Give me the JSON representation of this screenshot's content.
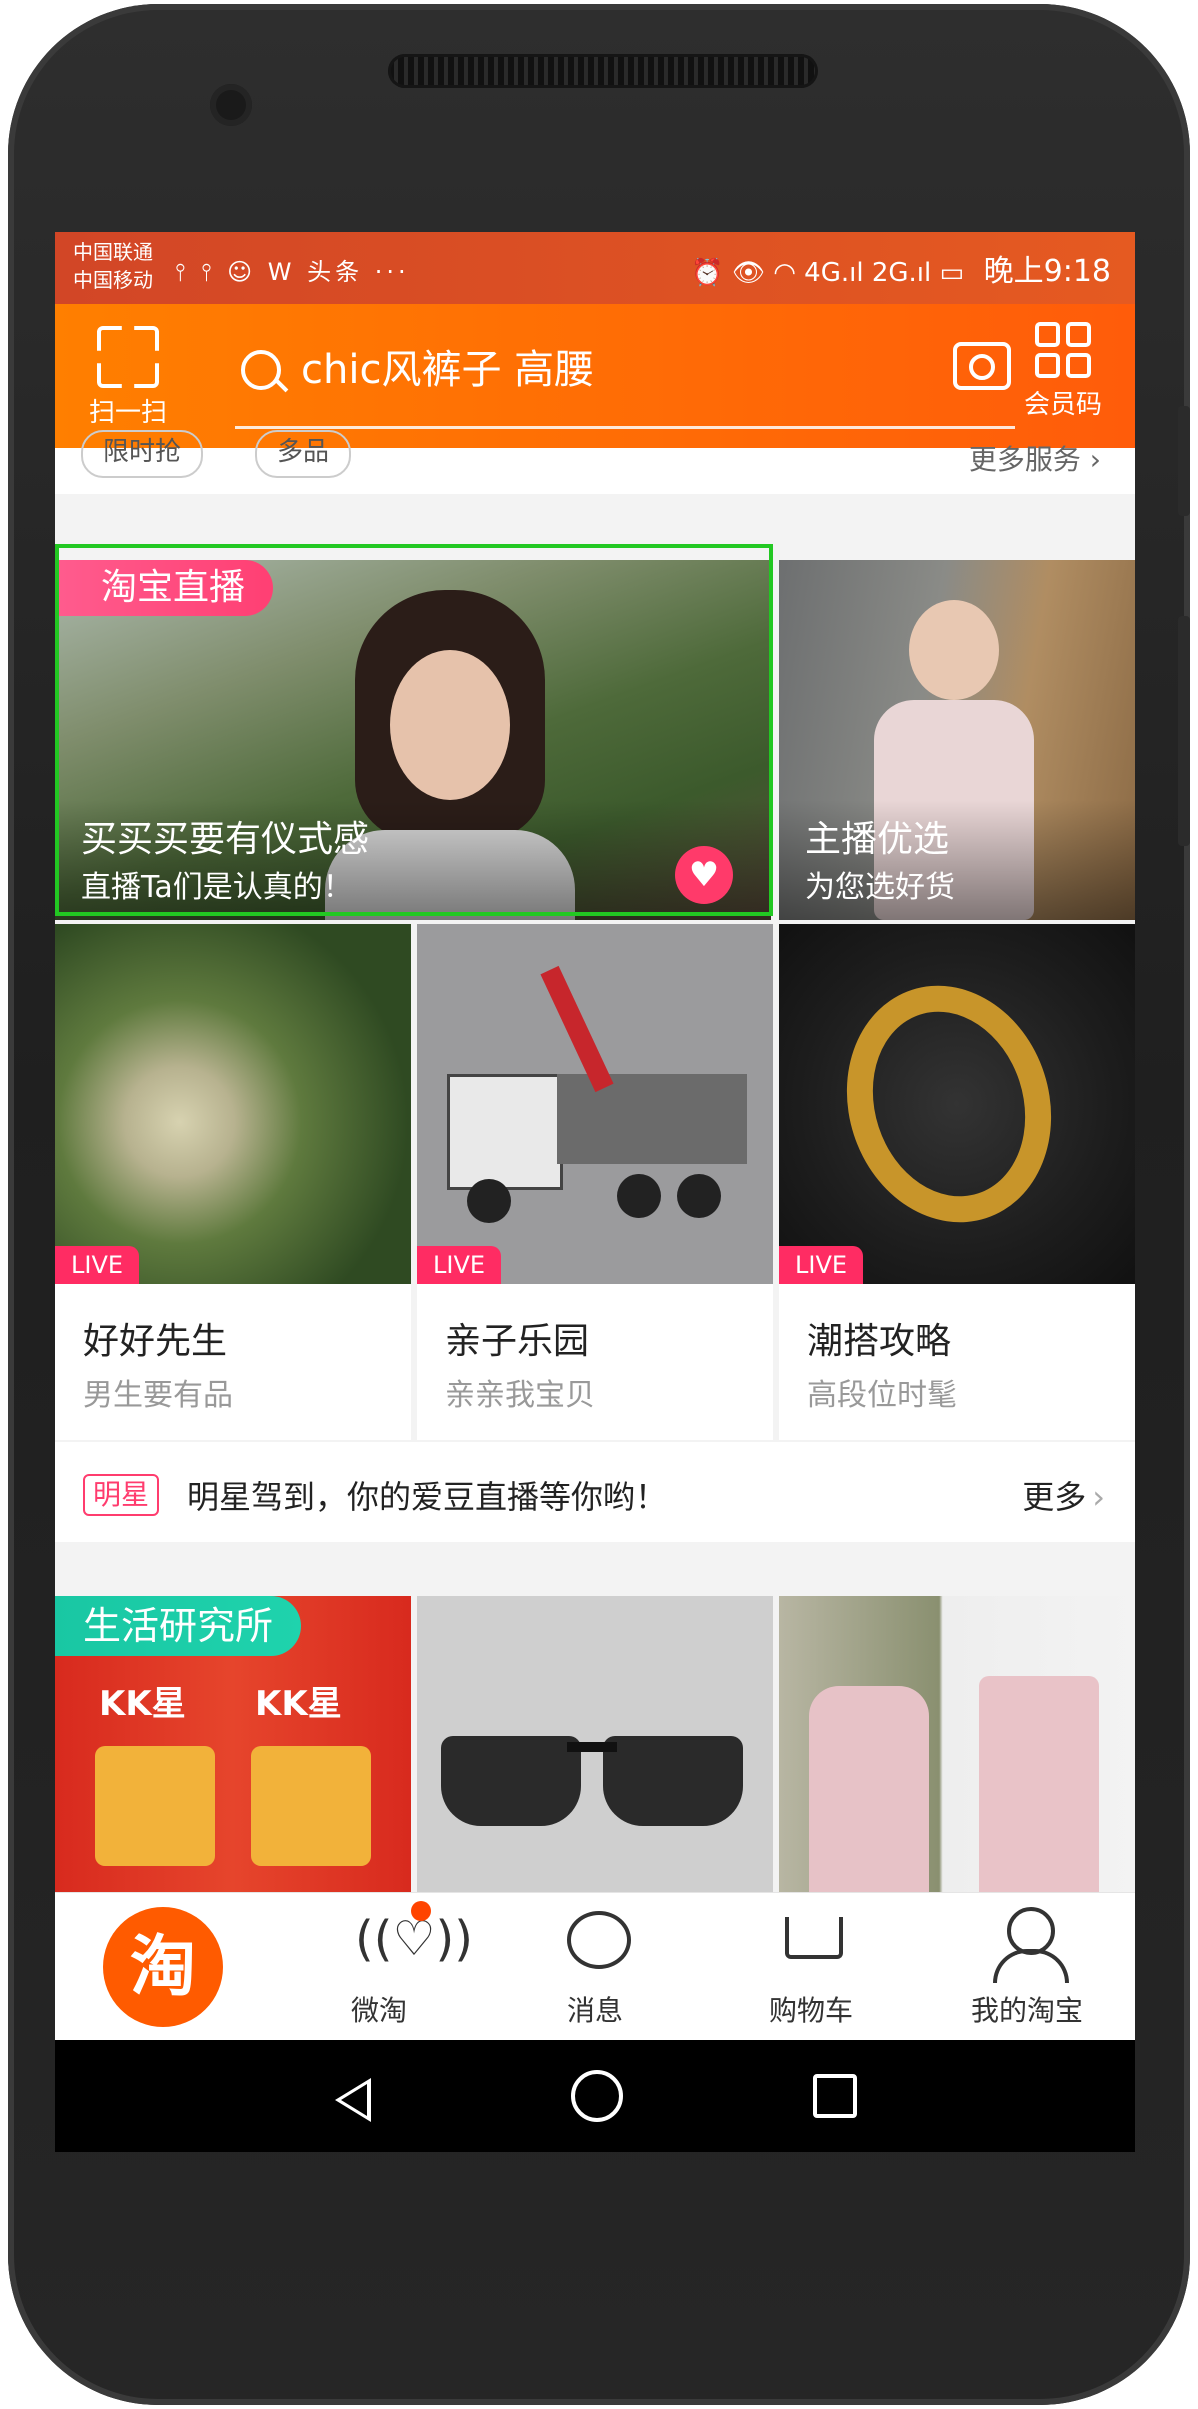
{
  "status_bar": {
    "carrier_1": "中国联通",
    "carrier_2": "中国移动",
    "left_icons": "⫯ ⫯ ☺ W 头条 ···",
    "right_icons": "⏰ 👁 ◠ 4G.ıl 2G.ıl ▭",
    "time": "晚上9:18"
  },
  "header": {
    "scan_label": "扫一扫",
    "search_query": "chic风裤子 高腰",
    "member_label": "会员码"
  },
  "top_strip": {
    "pill_1": "限时抢",
    "pill_2": "多品",
    "more": "更多服务 ›"
  },
  "live_section": {
    "banner": "淘宝直播",
    "featured": {
      "title": "买买买要有仪式感",
      "subtitle": "直播Ta们是认真的！"
    },
    "picks": {
      "title": "主播优选",
      "subtitle": "为您选好货"
    },
    "cards": [
      {
        "tag": "LIVE",
        "title": "好好先生",
        "subtitle": "男生要有品"
      },
      {
        "tag": "LIVE",
        "title": "亲子乐园",
        "subtitle": "亲亲我宝贝"
      },
      {
        "tag": "LIVE",
        "title": "潮搭攻略",
        "subtitle": "高段位时髦"
      }
    ]
  },
  "star_bar": {
    "tag": "明星",
    "text": "明星驾到，你的爱豆直播等你哟！",
    "more": "更多"
  },
  "life_section": {
    "banner": "生活研究所",
    "kk_label": "KK星"
  },
  "tabbar": {
    "home_logo": "淘",
    "items": [
      "微淘",
      "消息",
      "购物车",
      "我的淘宝"
    ]
  },
  "colors": {
    "accent_orange": "#ff5b00",
    "live_pink": "#ff3f73",
    "life_green": "#19c7a3",
    "highlight_green": "#22c822"
  }
}
